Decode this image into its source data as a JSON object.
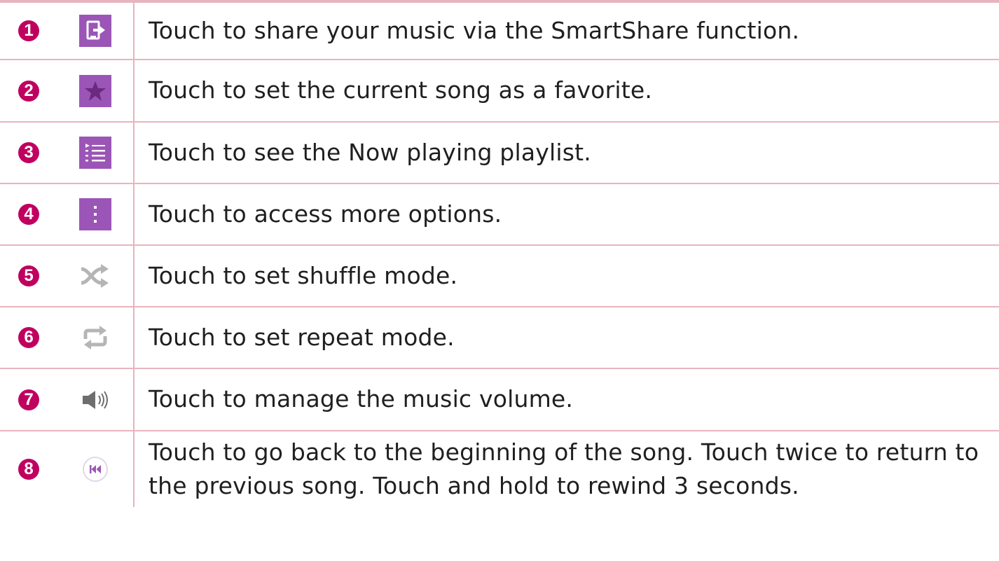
{
  "rows": [
    {
      "number": "1",
      "icon": "smartshare-icon",
      "text": "Touch to share your music via the SmartShare function."
    },
    {
      "number": "2",
      "icon": "star-favorite-icon",
      "text": "Touch to set the current song as a favorite."
    },
    {
      "number": "3",
      "icon": "playlist-icon",
      "text": "Touch to see the Now playing playlist."
    },
    {
      "number": "4",
      "icon": "more-options-icon",
      "text": "Touch to access more options."
    },
    {
      "number": "5",
      "icon": "shuffle-icon",
      "text": "Touch to set shuffle mode."
    },
    {
      "number": "6",
      "icon": "repeat-icon",
      "text": "Touch to set repeat mode."
    },
    {
      "number": "7",
      "icon": "volume-icon",
      "text": "Touch to manage the music volume."
    },
    {
      "number": "8",
      "icon": "rewind-previous-icon",
      "text": "Touch to go back to the beginning of the song. Touch twice to return to the previous song. Touch and hold to rewind 3 seconds."
    }
  ],
  "colors": {
    "accent": "#c0005f",
    "icon_bg": "#9b55b6",
    "icon_gray": "#b5b5b5",
    "border": "#e8b4bf"
  }
}
